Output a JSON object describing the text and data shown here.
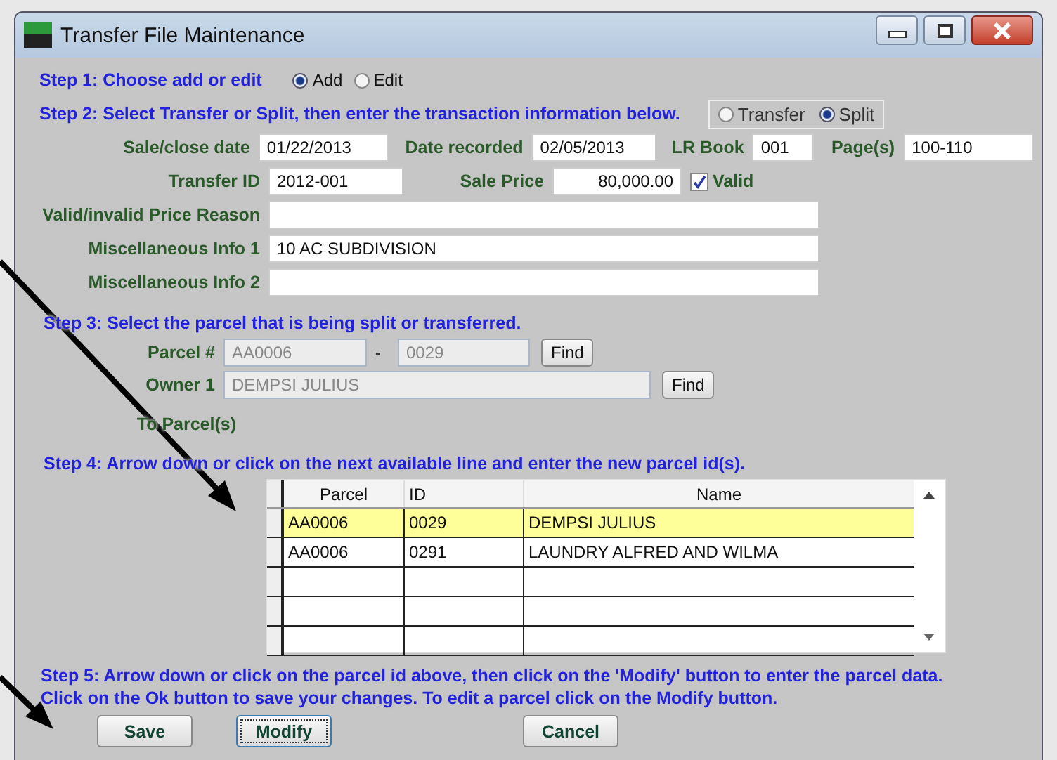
{
  "window": {
    "title": "Transfer File Maintenance"
  },
  "step1": {
    "label": "Step 1: Choose add or edit",
    "options": [
      {
        "label": "Add",
        "selected": true
      },
      {
        "label": "Edit",
        "selected": false
      }
    ]
  },
  "step2": {
    "label": "Step 2: Select Transfer or Split, then enter the transaction information below.",
    "options": [
      {
        "label": "Transfer",
        "selected": false
      },
      {
        "label": "Split",
        "selected": true
      }
    ]
  },
  "fields": {
    "sale_close_date": {
      "label": "Sale/close date",
      "value": "01/22/2013"
    },
    "date_recorded": {
      "label": "Date recorded",
      "value": "02/05/2013"
    },
    "lr_book": {
      "label": "LR Book",
      "value": "001"
    },
    "pages": {
      "label": "Page(s)",
      "value": "100-110"
    },
    "transfer_id": {
      "label": "Transfer ID",
      "value": "2012-001"
    },
    "sale_price": {
      "label": "Sale Price",
      "value": "80,000.00"
    },
    "valid": {
      "label": "Valid",
      "checked": true
    },
    "price_reason": {
      "label": "Valid/invalid Price Reason"
    },
    "misc_info_1": {
      "label": "Miscellaneous Info 1",
      "value": "10 AC SUBDIVISION"
    },
    "misc_info_2": {
      "label": "Miscellaneous Info 2"
    }
  },
  "step3": {
    "label": "Step 3: Select the parcel that is being split or transferred.",
    "parcel": {
      "label": "Parcel #",
      "prefix": "AA0006",
      "separator": "-",
      "number": "0029",
      "disabled": true,
      "button": "Find"
    },
    "owner": {
      "label": "Owner 1",
      "value": "DEMPSI JULIUS",
      "disabled": true,
      "button": "Find"
    },
    "to_parcels_label": "To Parcel(s)"
  },
  "step4": {
    "label": "Step 4: Arrow down or click on the next available line and enter the new parcel id(s)."
  },
  "table": {
    "columns": [
      "Parcel",
      "ID",
      "Name"
    ],
    "rows": [
      {
        "cells": [
          "AA0006",
          "0029",
          "DEMPSI JULIUS"
        ],
        "selected": true
      },
      {
        "cells": [
          "AA0006",
          "0291",
          "LAUNDRY ALFRED AND WILMA"
        ],
        "selected": false
      },
      {
        "cells": [],
        "selected": false
      },
      {
        "cells": [],
        "selected": false
      },
      {
        "cells": [],
        "selected": false
      }
    ]
  },
  "step5": {
    "lines": [
      "Step 5: Arrow down or click on  the parcel id above, then  click on the 'Modify' button to enter the parcel data.",
      "Click on the Ok button to save your changes. To edit a parcel click on the Modify button."
    ]
  },
  "buttons": [
    {
      "label": "Save",
      "focused": false
    },
    {
      "label": "Modify",
      "focused": true
    },
    {
      "label": "Cancel",
      "focused": false
    }
  ]
}
